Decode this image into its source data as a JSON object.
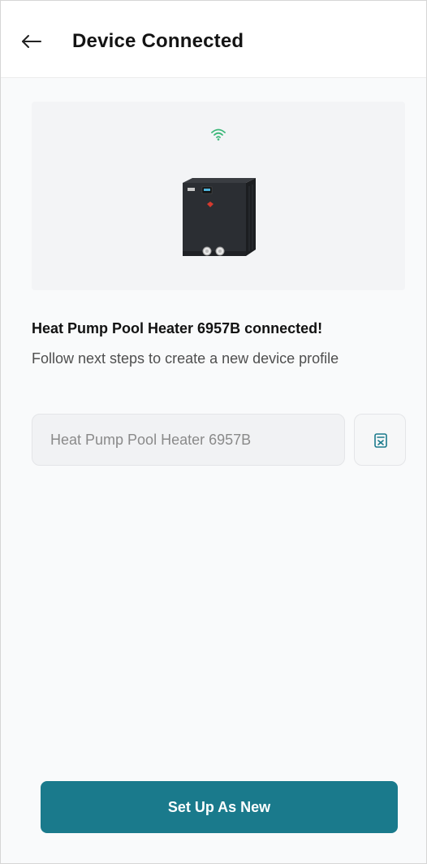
{
  "header": {
    "title": "Device Connected",
    "back_icon": "arrow-left-icon"
  },
  "hero": {
    "status_icon": "wifi-icon",
    "device_image": "heat-pump-device-image"
  },
  "message": {
    "title": "Heat Pump Pool Heater 6957B connected!",
    "subtitle": "Follow next steps to create a new device profile"
  },
  "name_field": {
    "value": "",
    "placeholder": "Heat Pump Pool Heater 6957B",
    "action_icon": "id-card-icon"
  },
  "primary_button": {
    "label": "Set Up As New"
  },
  "colors": {
    "accent": "#1a7a8c",
    "wifi": "#3db87a",
    "background": "#f9fafb"
  }
}
